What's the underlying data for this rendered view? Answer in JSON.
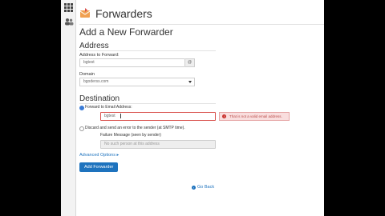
{
  "app": {
    "page_title": "Forwarders"
  },
  "form": {
    "heading": "Add a New Forwarder",
    "address_section": "Address",
    "address_label": "Address to Forward:",
    "address_value": "bgtest",
    "address_suffix": "@",
    "domain_label": "Domain",
    "domain_value": "bgoderss.com",
    "destination_section": "Destination",
    "forward_label": "Forward to Email Address:",
    "forward_value": "bgtest",
    "error_message": "That is not a valid email address.",
    "discard_label": "Discard and send an error to the sender (at SMTP time).",
    "failure_label": "Failure Message (seen by sender)",
    "failure_placeholder": "No such person at this address",
    "advanced_label": "Advanced Options",
    "submit_label": "Add Forwarder",
    "back_label": "Go Back"
  },
  "colors": {
    "accent": "#1e73be",
    "error": "#b94a48",
    "error_bg": "#f9dede"
  },
  "icons": {
    "apps": "grid-icon",
    "users": "users-icon",
    "logo": "envelope-forward-icon"
  }
}
